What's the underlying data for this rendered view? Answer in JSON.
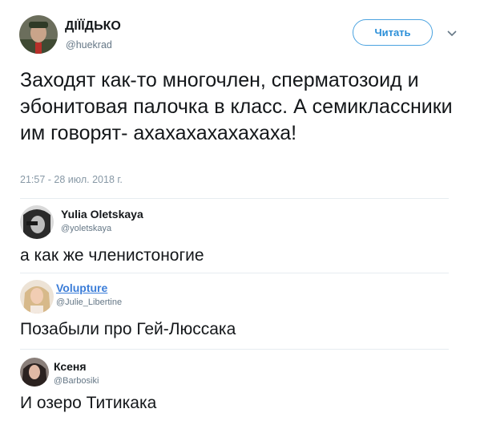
{
  "tweet": {
    "author_name": "ДІЇЇДЬКО",
    "author_handle": "@huekrad",
    "follow_label": "Читать",
    "text": "Заходят как-то многочлен, сперматозоид и эбонитовая палочка в класс. А семиклассники им говорят- ахахахахахахаха!",
    "timestamp": "21:57 - 28 июл. 2018 г."
  },
  "replies": [
    {
      "name": "Yulia Oletskaya",
      "handle": "@yoletskaya",
      "text": "а как же членистоногие"
    },
    {
      "name": "Volupture",
      "handle": "@Julie_Libertine",
      "text": "Позабыли про Гей-Люссака"
    },
    {
      "name": "Ксеня",
      "handle": "@Barbosiki",
      "text": "И озеро Титикака"
    }
  ],
  "colors": {
    "follow_border": "#4ba3e0",
    "link_name": "#3b7dd8",
    "muted": "#657786",
    "divider": "#e6ecf0"
  },
  "icons": {
    "more": "chevron-down-icon"
  }
}
